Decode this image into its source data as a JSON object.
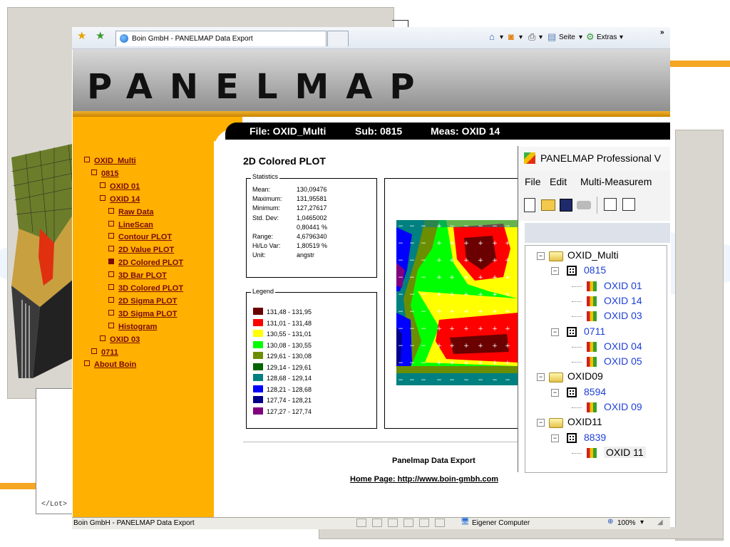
{
  "browser": {
    "tab_title": "Boin GmbH - PANELMAP Data Export",
    "commands": {
      "seite": "Seite",
      "extras": "Extras"
    },
    "status_text": "Boin GmbH - PANELMAP Data Export",
    "status_zone": "Eigener Computer",
    "zoom": "100%"
  },
  "page": {
    "logo": "PANELMAP",
    "filebar": {
      "file": "File: OXID_Multi",
      "sub": "Sub: 0815",
      "meas": "Meas: OXID 14"
    },
    "sidebar": [
      {
        "label": "OXID_Multi",
        "level": 0
      },
      {
        "label": "0815",
        "level": 1
      },
      {
        "label": "OXID 01",
        "level": 2
      },
      {
        "label": "OXID 14",
        "level": 2
      },
      {
        "label": "Raw Data",
        "level": 3
      },
      {
        "label": "LineScan",
        "level": 3
      },
      {
        "label": "Contour PLOT",
        "level": 3
      },
      {
        "label": "2D Value PLOT",
        "level": 3
      },
      {
        "label": "2D Colored PLOT",
        "level": 3,
        "current": true
      },
      {
        "label": "3D Bar PLOT",
        "level": 3
      },
      {
        "label": "3D Colored PLOT",
        "level": 3
      },
      {
        "label": "2D Sigma PLOT",
        "level": 3
      },
      {
        "label": "3D Sigma PLOT",
        "level": 3
      },
      {
        "label": "Histogram",
        "level": 3
      },
      {
        "label": "OXID 03",
        "level": 2
      },
      {
        "label": "0711",
        "level": 1
      },
      {
        "label": "About Boin",
        "level": 0
      }
    ],
    "plot_title": "2D Colored PLOT",
    "stats_label": "Statistics",
    "stats": [
      {
        "k": "Mean:",
        "v": "130,09476"
      },
      {
        "k": "Maximum:",
        "v": "131,95581"
      },
      {
        "k": "Minimum:",
        "v": "127,27617"
      },
      {
        "k": "Std. Dev:",
        "v": "1,0465002"
      },
      {
        "k": "",
        "v": "0,80441 %"
      },
      {
        "k": "Range:",
        "v": "4,6796340"
      },
      {
        "k": "Hi/Lo Var:",
        "v": "1,80519 %"
      },
      {
        "k": "Unit:",
        "v": "angstr"
      }
    ],
    "legend_label": "Legend",
    "legend": [
      {
        "color": "#6b0000",
        "text": "131,48 - 131,95"
      },
      {
        "color": "#ff0000",
        "text": "131,01 - 131,48"
      },
      {
        "color": "#ffff00",
        "text": "130,55 - 131,01"
      },
      {
        "color": "#00ff00",
        "text": "130,08 - 130,55"
      },
      {
        "color": "#6b8e00",
        "text": "129,61 - 130,08"
      },
      {
        "color": "#006400",
        "text": "129,14 - 129,61"
      },
      {
        "color": "#008080",
        "text": "128,68 - 129,14"
      },
      {
        "color": "#0000ff",
        "text": "128,21 - 128,68"
      },
      {
        "color": "#00008b",
        "text": "127,74 - 128,21"
      },
      {
        "color": "#800080",
        "text": "127,27 - 127,74"
      }
    ],
    "footer_title": "Panelmap Data Export",
    "footer_link": "Home Page: http://www.boin-gmbh.com"
  },
  "pro_window": {
    "title": "PANELMAP  Professional V",
    "menu": [
      "File",
      "Edit",
      "Multi-Measurem"
    ],
    "tree": [
      {
        "label": "OXID_Multi",
        "type": "folder"
      },
      {
        "label": "0815",
        "type": "grid"
      },
      {
        "label": "OXID 01",
        "type": "meas"
      },
      {
        "label": "OXID 14",
        "type": "meas"
      },
      {
        "label": "OXID 03",
        "type": "meas"
      },
      {
        "label": "0711",
        "type": "grid"
      },
      {
        "label": "OXID 04",
        "type": "meas"
      },
      {
        "label": "OXID 05",
        "type": "meas"
      },
      {
        "label": "OXID09",
        "type": "folder"
      },
      {
        "label": "8594",
        "type": "grid"
      },
      {
        "label": "OXID 09",
        "type": "meas"
      },
      {
        "label": "OXID11",
        "type": "folder"
      },
      {
        "label": "8839",
        "type": "grid"
      },
      {
        "label": "OXID 11",
        "type": "meas",
        "selected": true
      }
    ]
  },
  "back_code": "</Lot>",
  "chart_data": {
    "type": "heatmap",
    "title": "2D Colored PLOT",
    "note": "Colored wafer thickness map; color bands follow the legend ranges",
    "color_scale": [
      "#800080",
      "#00008b",
      "#0000ff",
      "#008080",
      "#006400",
      "#6b8e00",
      "#00ff00",
      "#ffff00",
      "#ff0000",
      "#6b0000"
    ]
  }
}
